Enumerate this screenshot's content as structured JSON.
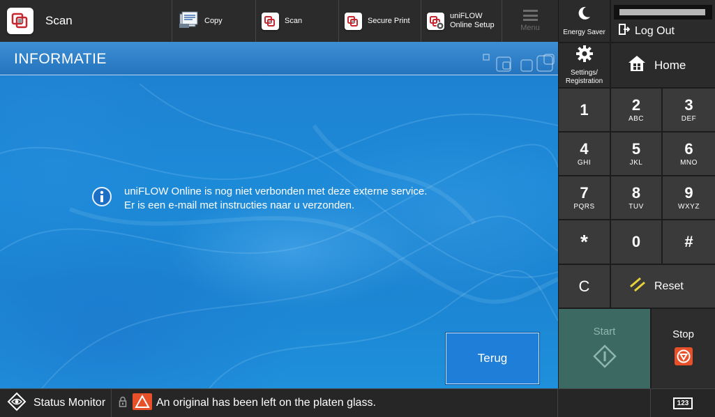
{
  "topbar": {
    "current_app": "Scan",
    "shortcuts": [
      {
        "label": "Copy",
        "icon": "copy-icon"
      },
      {
        "label": "Scan",
        "icon": "uniflow-scan-icon"
      },
      {
        "label": "Secure Print",
        "icon": "uniflow-secure-print-icon"
      },
      {
        "label": "uniFLOW Online Setup",
        "icon": "uniflow-setup-icon"
      }
    ],
    "menu_label": "Menu"
  },
  "main": {
    "title": "INFORMATIE",
    "message_line1": "uniFLOW Online is nog niet verbonden met deze externe service.",
    "message_line2": "Er is een e-mail met instructies naar u verzonden.",
    "back_button": "Terug"
  },
  "right_panel": {
    "energy_saver": "Energy Saver",
    "log_out": "Log Out",
    "settings_line1": "Settings/",
    "settings_line2": "Registration",
    "home": "Home",
    "keys": [
      {
        "num": "1",
        "sub": ""
      },
      {
        "num": "2",
        "sub": "ABC"
      },
      {
        "num": "3",
        "sub": "DEF"
      },
      {
        "num": "4",
        "sub": "GHI"
      },
      {
        "num": "5",
        "sub": "JKL"
      },
      {
        "num": "6",
        "sub": "MNO"
      },
      {
        "num": "7",
        "sub": "PQRS"
      },
      {
        "num": "8",
        "sub": "TUV"
      },
      {
        "num": "9",
        "sub": "WXYZ"
      },
      {
        "num": "*",
        "sub": ""
      },
      {
        "num": "0",
        "sub": ""
      },
      {
        "num": "#",
        "sub": ""
      }
    ],
    "clear": "C",
    "reset": "Reset",
    "start": "Start",
    "stop": "Stop"
  },
  "statusbar": {
    "status_monitor": "Status Monitor",
    "message": "An original has been left on the platen glass.",
    "counter_label": "123"
  },
  "colors": {
    "accent_blue": "#1f7fd8",
    "start_green": "#3c6a62",
    "stop_orange": "#e8502a",
    "warning_orange": "#e8502a",
    "reset_yellow": "#e8d23a"
  }
}
